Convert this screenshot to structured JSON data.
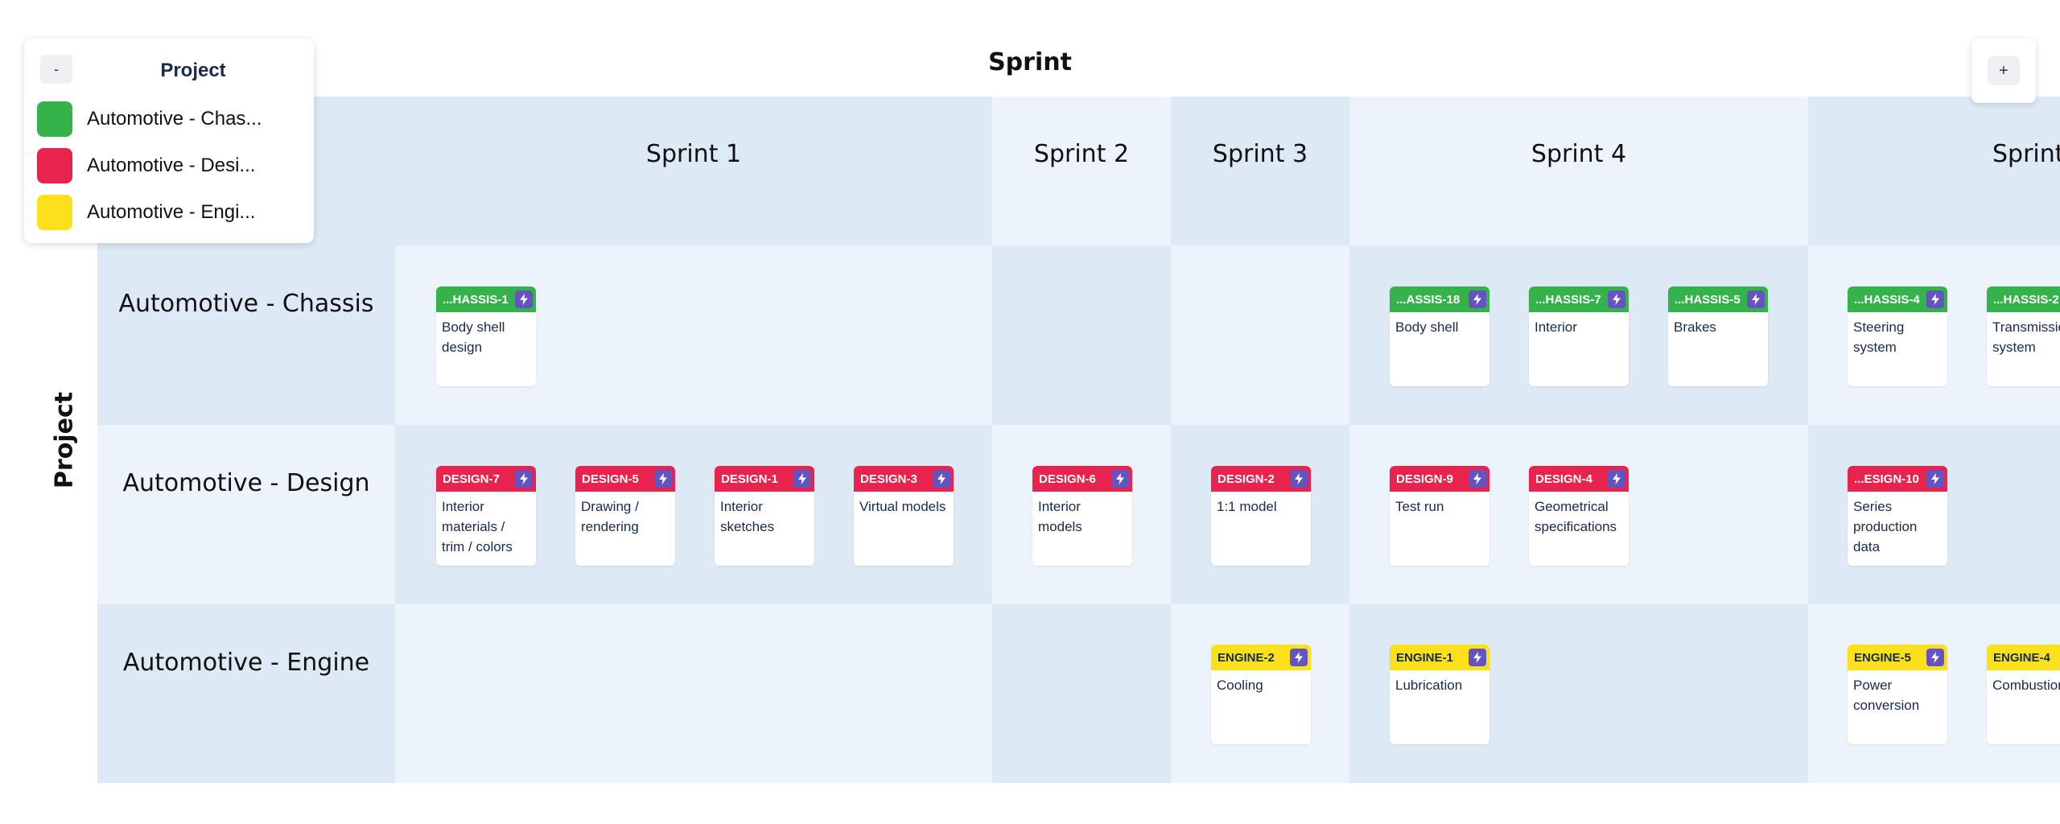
{
  "board": {
    "column_axis_title": "Sprint",
    "row_axis_title": "Project"
  },
  "sprints": [
    "Sprint 1",
    "Sprint 2",
    "Sprint 3",
    "Sprint 4",
    "Sprint"
  ],
  "projects": [
    "Automotive - Chassis",
    "Automotive - Design",
    "Automotive - Engine"
  ],
  "legend": {
    "toggle_label": "-",
    "title": "Project",
    "items": [
      {
        "label": "Automotive - Chas...",
        "color": "#36b24a"
      },
      {
        "label": "Automotive - Desi...",
        "color": "#e8244e"
      },
      {
        "label": "Automotive - Engi...",
        "color": "#fbe01a"
      }
    ]
  },
  "add_button": {
    "label": "+"
  },
  "colors": {
    "chassis": "#36b24a",
    "design": "#e8244e",
    "engine": "#fbe01a",
    "icon_badge": "#6554c0",
    "cell_dark": "#dde9f5",
    "cell_light": "#ecf3fa"
  },
  "icon_name": "lightning-bolt-icon",
  "cards": {
    "chassis_1": {
      "key": "...HASSIS-1",
      "summary": "Body shell design"
    },
    "chassis_18": {
      "key": "...ASSIS-18",
      "summary": "Body shell"
    },
    "chassis_7": {
      "key": "...HASSIS-7",
      "summary": "Interior"
    },
    "chassis_5": {
      "key": "...HASSIS-5",
      "summary": "Brakes"
    },
    "chassis_4": {
      "key": "...HASSIS-4",
      "summary": "Steering system"
    },
    "chassis_2": {
      "key": "...HASSIS-2",
      "summary": "Transmission system"
    },
    "design_7": {
      "key": "DESIGN-7",
      "summary": "Interior materials / trim / colors"
    },
    "design_5": {
      "key": "DESIGN-5",
      "summary": "Drawing / rendering"
    },
    "design_1": {
      "key": "DESIGN-1",
      "summary": "Interior sketches"
    },
    "design_3": {
      "key": "DESIGN-3",
      "summary": "Virtual models"
    },
    "design_6": {
      "key": "DESIGN-6",
      "summary": "Interior models"
    },
    "design_2": {
      "key": "DESIGN-2",
      "summary": "1:1 model"
    },
    "design_9": {
      "key": "DESIGN-9",
      "summary": "Test run"
    },
    "design_4": {
      "key": "DESIGN-4",
      "summary": "Geometrical specifications"
    },
    "design_10": {
      "key": "...ESIGN-10",
      "summary": "Series production data"
    },
    "engine_2": {
      "key": "ENGINE-2",
      "summary": "Cooling"
    },
    "engine_1": {
      "key": "ENGINE-1",
      "summary": "Lubrication"
    },
    "engine_5": {
      "key": "ENGINE-5",
      "summary": "Power conversion"
    },
    "engine_4": {
      "key": "ENGINE-4",
      "summary": "Combustion"
    }
  }
}
